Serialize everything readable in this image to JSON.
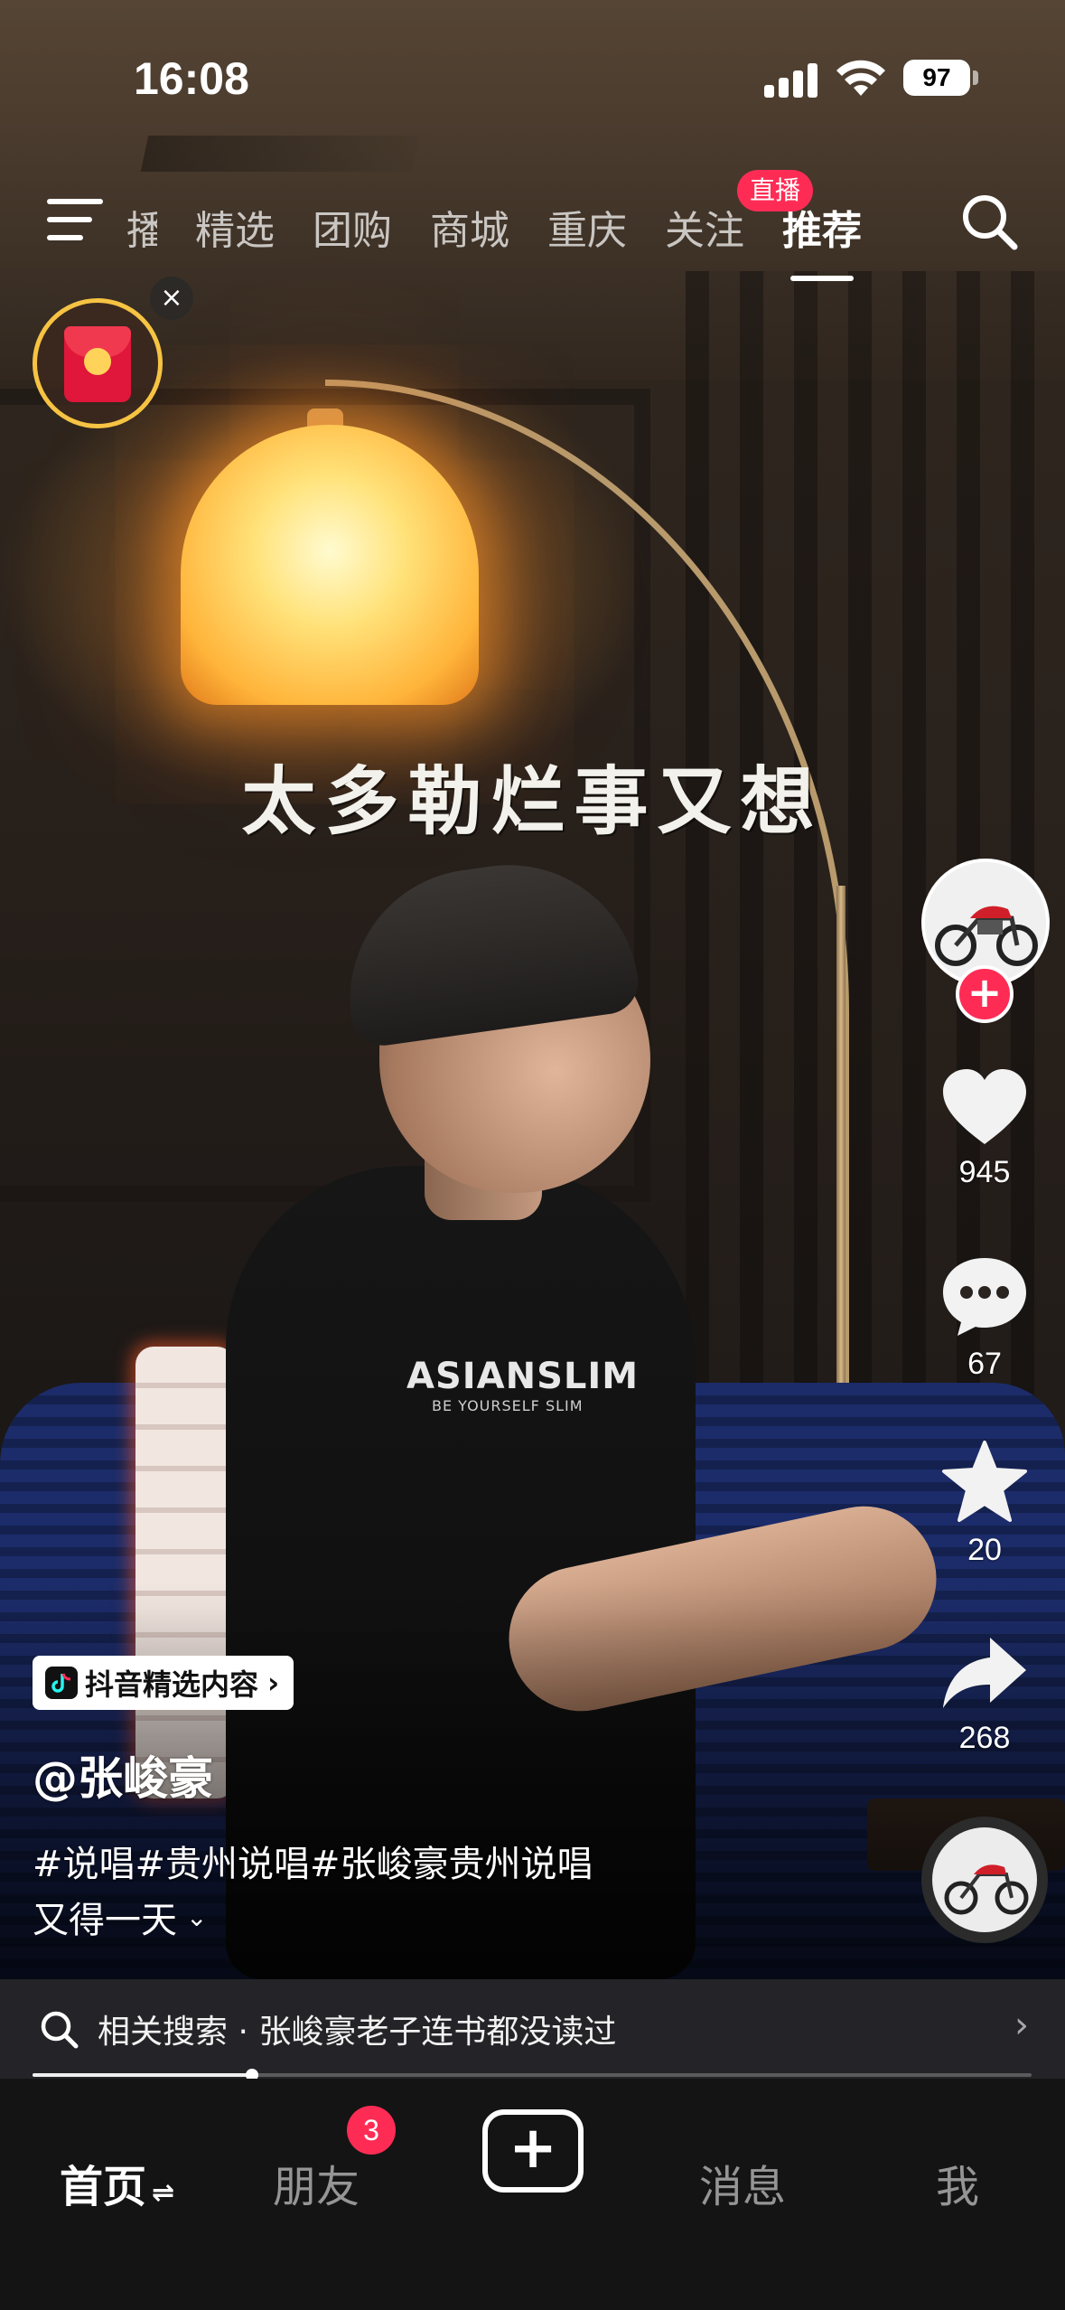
{
  "status_bar": {
    "time": "16:08",
    "battery": "97"
  },
  "top_nav": {
    "tabs": [
      {
        "label": "播",
        "partial": true
      },
      {
        "label": "精选"
      },
      {
        "label": "团购"
      },
      {
        "label": "商城"
      },
      {
        "label": "重庆"
      },
      {
        "label": "关注"
      },
      {
        "label": "推荐",
        "active": true
      }
    ],
    "live_badge": "直播"
  },
  "red_packet": {
    "close_glyph": "×"
  },
  "video": {
    "caption": "太多勒烂事又想",
    "shirt_text_1": "ASIANSLIM",
    "shirt_text_2": "BE YOURSELF SLIM"
  },
  "right_rail": {
    "likes": "945",
    "comments": "67",
    "favorites": "20",
    "shares": "268",
    "follow_glyph": "+"
  },
  "info": {
    "selected_tag": "抖音精选内容",
    "author": "@张峻豪",
    "hashtags": "#说唱#贵州说唱#张峻豪贵州说唱",
    "description": "又得一天"
  },
  "related_search": {
    "text": "相关搜索 · 张峻豪老子连书都没读过"
  },
  "progress": {
    "fraction": 0.22
  },
  "tabbar": {
    "home": "首页",
    "friends": "朋友",
    "friends_badge": "3",
    "create": "+",
    "messages": "消息",
    "me": "我"
  },
  "colors": {
    "accent": "#fe2c55",
    "tabbar_bg": "#141414",
    "gold_ring": "#f6c343"
  }
}
